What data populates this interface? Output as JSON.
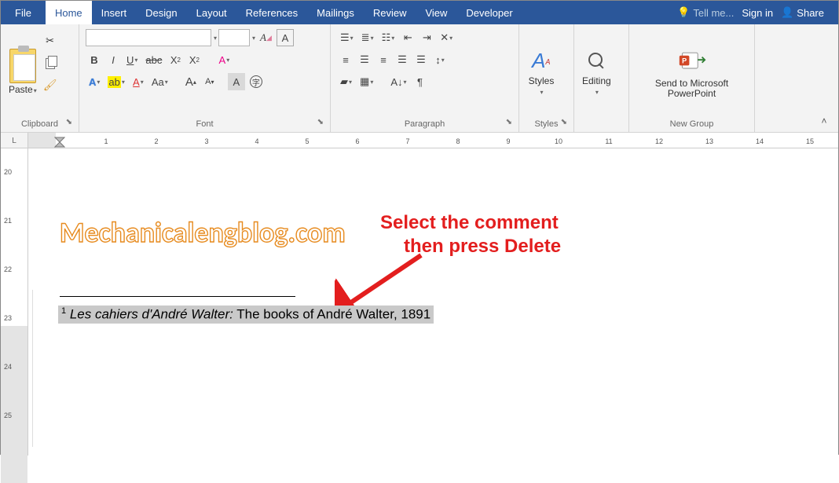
{
  "tabs": {
    "file": "File",
    "home": "Home",
    "insert": "Insert",
    "design": "Design",
    "layout": "Layout",
    "references": "References",
    "mailings": "Mailings",
    "review": "Review",
    "view": "View",
    "developer": "Developer"
  },
  "titlebar": {
    "tell_me": "Tell me...",
    "sign_in": "Sign in",
    "share": "Share"
  },
  "ribbon": {
    "clipboard": {
      "label": "Clipboard",
      "paste": "Paste"
    },
    "font": {
      "label": "Font",
      "name": "",
      "size": ""
    },
    "paragraph": {
      "label": "Paragraph"
    },
    "styles": {
      "label": "Styles",
      "button": "Styles"
    },
    "editing": {
      "label": "",
      "button": "Editing"
    },
    "newgroup": {
      "label": "New Group",
      "send_line1": "Send to Microsoft",
      "send_line2": "PowerPoint"
    }
  },
  "ruler_h": {
    "corner": "L",
    "numbers": [
      1,
      2,
      3,
      4,
      5,
      6,
      7,
      8,
      9,
      10,
      11,
      12,
      13,
      14,
      15
    ]
  },
  "ruler_v": {
    "numbers": [
      20,
      21,
      22,
      23,
      24,
      25
    ]
  },
  "doc": {
    "watermark": "Mechanicalengblog.com",
    "annotation_line1": "Select the comment",
    "annotation_line2": "then press Delete",
    "footnote_num": "1",
    "footnote_ital": " Les cahiers d'André Walter:",
    "footnote_rest": " The books of André Walter, 1891"
  }
}
